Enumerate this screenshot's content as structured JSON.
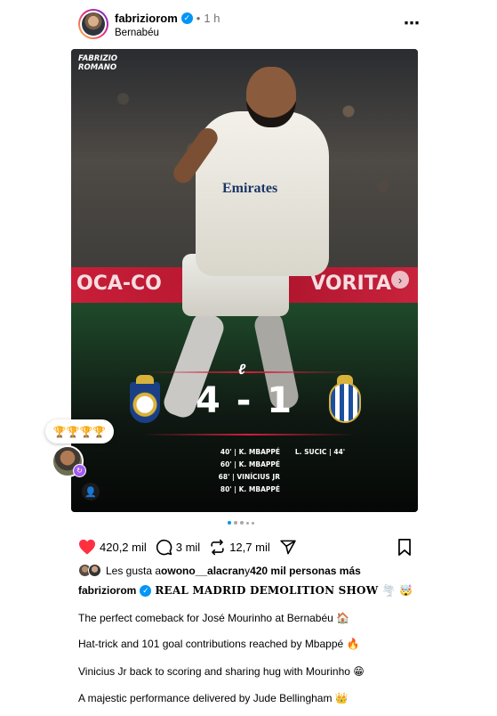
{
  "post": {
    "username": "fabriziorom",
    "verified_mark": "✓",
    "separator": "•",
    "time": "1 h",
    "location": "Bernabéu",
    "more_icon": "⋯"
  },
  "media": {
    "brand_line1": "FABRIZIO",
    "brand_line2": "ROMANO",
    "banner_left": "OCA-CO",
    "banner_right": "VORITA",
    "sponsor": "Emirates",
    "league_mark": "ℓ",
    "score": "4 - 1",
    "home_scorers": [
      "40' | K. MBAPPÉ",
      "60' | K. MBAPPÉ",
      "68' | VINÍCIUS JR",
      "80' | K. MBAPPÉ"
    ],
    "away_scorers": [
      "L. SUCIC | 44'"
    ],
    "next_icon": "›",
    "user_tag_icon": "👤"
  },
  "reaction": {
    "emojis": "🏆🏆🏆🏆",
    "badge_icon": "↻"
  },
  "actions": {
    "likes": "420,2 mil",
    "comments": "3 mil",
    "reposts": "12,7 mil"
  },
  "likes_line": {
    "prefix": "Les gusta a ",
    "user": "owono__alacran",
    "middle": " y ",
    "count": "420 mil personas más"
  },
  "caption": {
    "username": "fabriziorom",
    "headline": "REAL MADRID DEMOLITION SHOW 🌪️ 🤯",
    "lines": [
      "The perfect comeback for José Mourinho at Bernabéu 🏠",
      "Hat-trick and 101 goal contributions reached by Mbappé 🔥",
      "Vinicius Jr back to scoring and sharing hug with Mourinho 😁",
      "A majestic performance delivered by Jude Bellingham 👑"
    ]
  },
  "colors": {
    "like_red": "#ff3040",
    "verified_blue": "#0095f6",
    "accent_red": "#d11f3b"
  }
}
